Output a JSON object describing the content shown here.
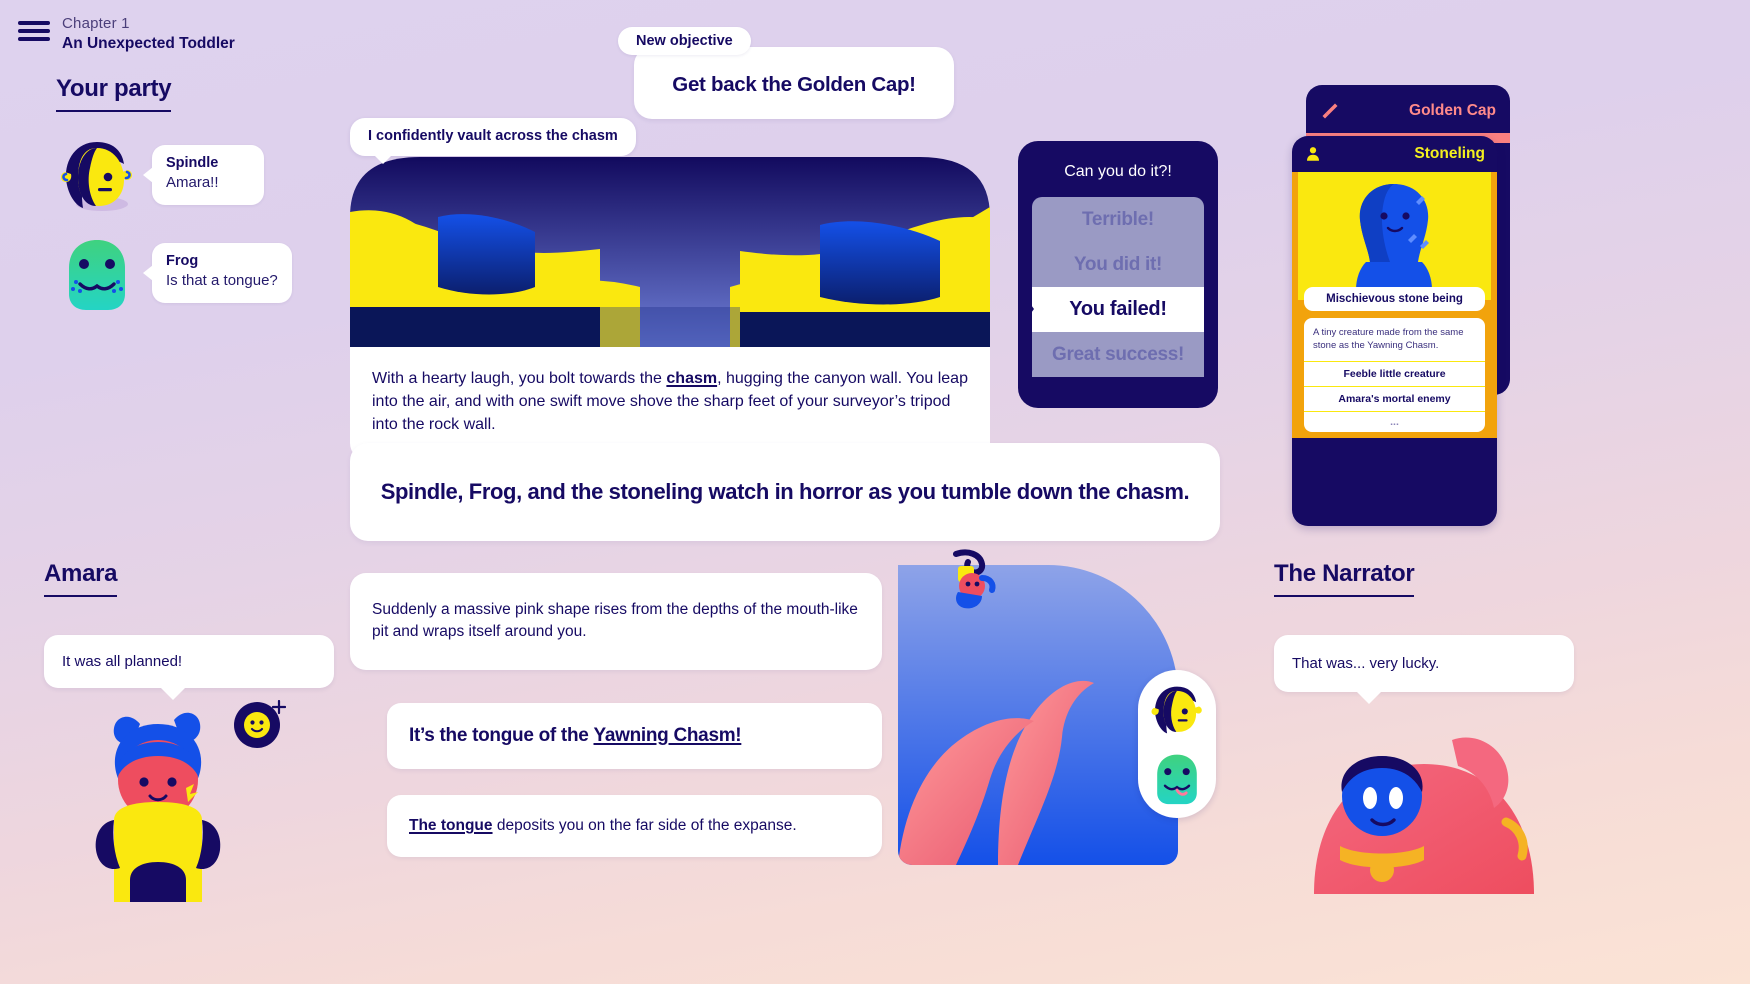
{
  "header": {
    "menu_icon": "hamburger-menu-icon",
    "chapter_number": "Chapter 1",
    "chapter_title": "An Unexpected Toddler"
  },
  "party": {
    "heading": "Your party",
    "members": [
      {
        "name": "Spindle",
        "line": "Amara!!",
        "avatar_icon": "spindle-avatar"
      },
      {
        "name": "Frog",
        "line": "Is that a tongue?",
        "avatar_icon": "frog-avatar"
      }
    ]
  },
  "objective": {
    "tag": "New objective",
    "title": "Get back the Golden Cap!"
  },
  "scene": {
    "action_bubble": "I confidently vault across the chasm",
    "narrative_before": "With a hearty laugh, you bolt towards the ",
    "narrative_link": "chasm",
    "narrative_after": ", hugging the canyon wall. You leap into the air, and with one swift move shove the sharp feet of your surveyor’s tripod into the rock wall."
  },
  "dice": {
    "question": "Can you do it?!",
    "options": [
      "Terrible!",
      "You did it!",
      "You failed!",
      "Great success!"
    ],
    "selected_index": 2,
    "marker_icon": "selection-arrow-icon"
  },
  "cards": {
    "back": {
      "title": "Golden Cap",
      "icon": "sword-icon",
      "accent": "#fa8080"
    },
    "front": {
      "title": "Stoneling",
      "icon": "person-icon",
      "accent": "#f4f01e",
      "name_pill": "Mischievous stone being",
      "description": "A tiny creature made from the same stone as the Yawning Chasm.",
      "traits": [
        "Feeble little creature",
        "Amara's mortal enemy",
        "..."
      ]
    }
  },
  "horror_banner": {
    "text": "Spindle, Frog, and the stoneling watch in horror as you tumble down the chasm."
  },
  "lower_cards": {
    "a": "Suddenly a massive pink shape rises from the depths of the mouth-like pit and wraps itself around you.",
    "b_before": "It’s the tongue of the ",
    "b_link": "Yawning Chasm!",
    "c_link": "The tongue",
    "c_after": " deposits you on the far side of the expanse."
  },
  "amara": {
    "heading": "Amara",
    "line": "It was all planned!",
    "badge_icon": "smiley-face-icon",
    "plus_icon": "plus-icon",
    "art_icon": "amara-character-art"
  },
  "narrator": {
    "heading": "The Narrator",
    "line": "That was... very lucky.",
    "art_icon": "narrator-character-art"
  },
  "mini_party": {
    "icons": [
      "spindle-mini-avatar",
      "frog-mini-avatar"
    ]
  },
  "colors": {
    "navy": "#160a63",
    "yellow": "#fae80f",
    "blue": "#1450e8",
    "pink": "#fa8080",
    "card_orange": "#f2a30c"
  }
}
